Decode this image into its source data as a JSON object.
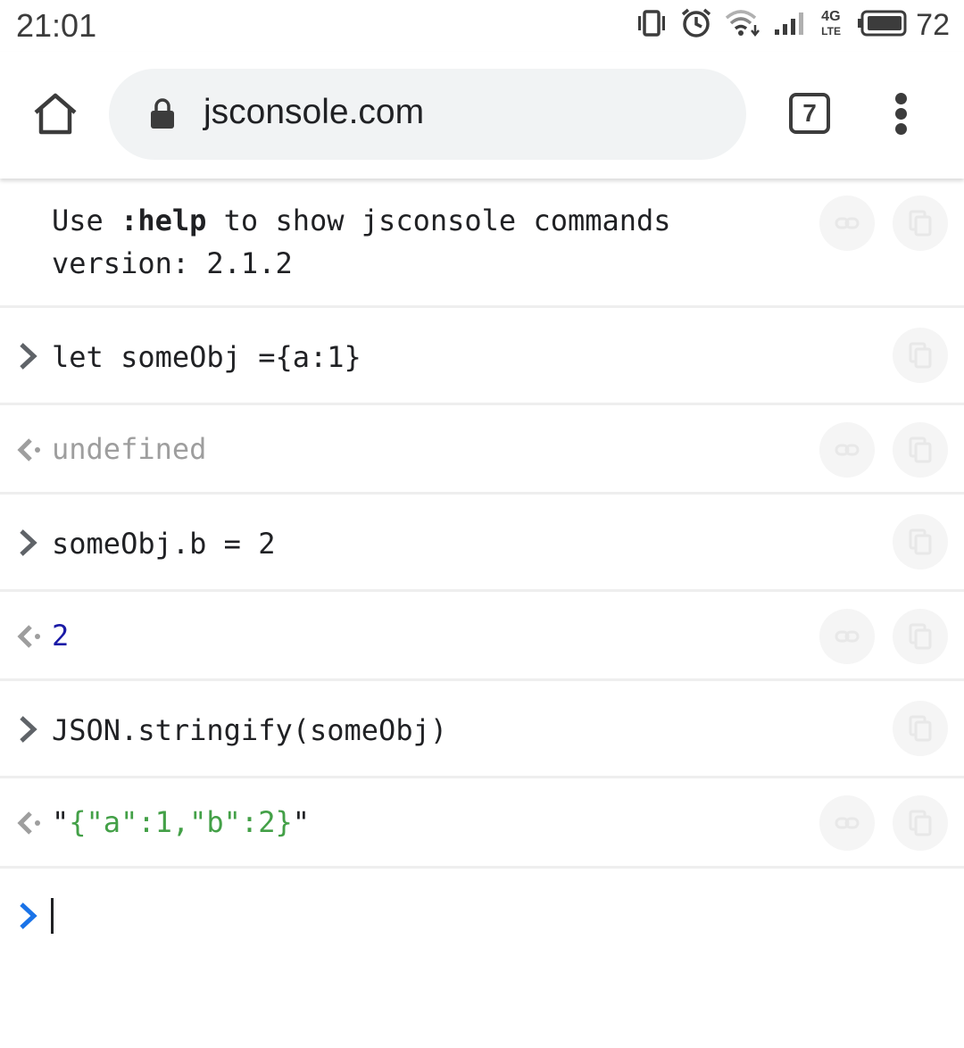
{
  "status_bar": {
    "time": "21:01",
    "network_label": "4G",
    "network_sub": "LTE",
    "battery_level": "72",
    "icons": [
      "vibrate-icon",
      "alarm-icon",
      "wifi-icon",
      "signal-icon",
      "network-4g-icon",
      "battery-icon"
    ]
  },
  "browser": {
    "url": "jsconsole.com",
    "tab_count": "7",
    "icons": [
      "home-icon",
      "lock-icon",
      "more-vert-icon"
    ]
  },
  "console": {
    "welcome": {
      "line1_pre": "Use ",
      "line1_cmd": ":help",
      "line1_post": " to show jsconsole commands",
      "line2": "version: 2.1.2"
    },
    "entries": [
      {
        "type": "input",
        "text": "let someObj ={a:1}"
      },
      {
        "type": "output",
        "text": "undefined"
      },
      {
        "type": "input",
        "text": "someObj.b = 2"
      },
      {
        "type": "output",
        "text": "2"
      },
      {
        "type": "input",
        "text": "JSON.stringify(someObj)"
      },
      {
        "type": "output",
        "quote_open": "\"",
        "text": "{\"a\":1,\"b\":2}",
        "quote_close": "\""
      }
    ],
    "input_value": ""
  },
  "colors": {
    "input_prompt": "#5f6368",
    "output_prompt": "#9e9e9e",
    "active_prompt": "#1a73e8",
    "number": "#1a1aa6",
    "string": "#43a047",
    "undefined": "#9e9e9e"
  }
}
